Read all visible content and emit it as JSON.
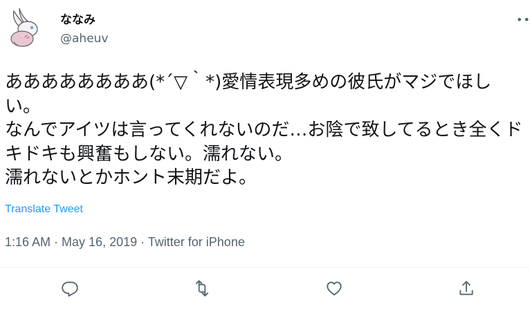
{
  "tweet": {
    "display_name": "ななみ",
    "handle": "@aheuv",
    "more_label": "•••",
    "text": "ああああああああ(*´▽｀*)愛情表現多めの彼氏がマジでほしい。\nなんでアイツは言ってくれないのだ…お陰で致してるとき全くドキドキも興奮もしない。濡れない。\n濡れないとかホント末期だよ。",
    "translate_label": "Translate Tweet",
    "timestamp": "1:16 AM · May 16, 2019 · Twitter for iPhone"
  },
  "actions": {
    "reply_icon": "reply-icon",
    "retweet_icon": "retweet-icon",
    "like_icon": "like-icon",
    "share_icon": "share-icon"
  },
  "colors": {
    "text": "#0f1419",
    "secondary": "#536471",
    "link": "#1d9bf0",
    "divider": "#eff3f4"
  }
}
